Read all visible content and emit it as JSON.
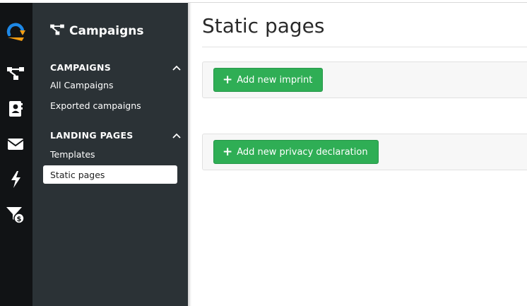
{
  "rail": {
    "icons": [
      "brand-logo-icon",
      "campaigns-icon",
      "contacts-icon",
      "mail-icon",
      "automation-icon",
      "funnel-dollar-icon"
    ]
  },
  "panel": {
    "title": "Campaigns",
    "sections": [
      {
        "heading": "CAMPAIGNS",
        "items": [
          "All Campaigns",
          "Exported campaigns"
        ]
      },
      {
        "heading": "LANDING PAGES",
        "items": [
          "Templates",
          "Static pages"
        ]
      }
    ],
    "active_item": "Static pages"
  },
  "main": {
    "title": "Static pages",
    "buttons": {
      "imprint": "Add new imprint",
      "privacy": "Add new privacy declaration"
    }
  },
  "colors": {
    "rail_bg": "#111315",
    "panel_bg": "#2b3236",
    "accent_green": "#2fae55",
    "logo_blue": "#1e88e5",
    "logo_orange": "#f39c12"
  }
}
